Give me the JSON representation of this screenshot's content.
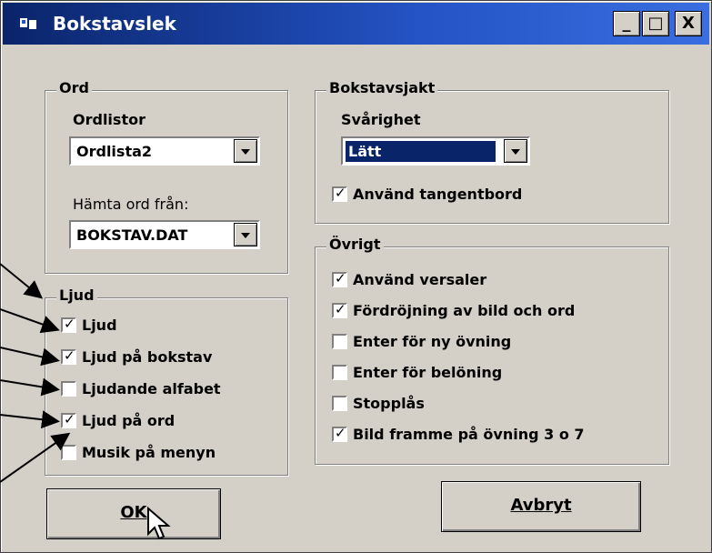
{
  "window": {
    "title": "Bokstavslek",
    "minimize": "_",
    "maximize": "□",
    "close": "X"
  },
  "ord": {
    "legend": "Ord",
    "ordlistor_label": "Ordlistor",
    "ordlistor_value": "Ordlista2",
    "hamta_label": "Hämta ord från:",
    "hamta_value": "BOKSTAV.DAT"
  },
  "bokstavsjakt": {
    "legend": "Bokstavsjakt",
    "svarighet_label": "Svårighet",
    "svarighet_value": "Lätt",
    "tangentbord": {
      "label": "Använd tangentbord",
      "checked": true
    }
  },
  "ljud": {
    "legend": "Ljud",
    "items": [
      {
        "label": "Ljud",
        "checked": true
      },
      {
        "label": "Ljud på bokstav",
        "checked": true
      },
      {
        "label": "Ljudande alfabet",
        "checked": false
      },
      {
        "label": "Ljud på ord",
        "checked": true
      },
      {
        "label": "Musik på menyn",
        "checked": false
      }
    ]
  },
  "ovrigt": {
    "legend": "Övrigt",
    "items": [
      {
        "label": "Använd versaler",
        "checked": true
      },
      {
        "label": "Fördröjning av bild och ord",
        "checked": true
      },
      {
        "label": "Enter för ny övning",
        "checked": false
      },
      {
        "label": "Enter för belöning",
        "checked": false
      },
      {
        "label": "Stopplås",
        "checked": false
      },
      {
        "label": "Bild framme på övning 3 o 7",
        "checked": true
      }
    ]
  },
  "buttons": {
    "ok": "OK",
    "avbryt": "Avbryt"
  },
  "colors": {
    "titlebar": "#0a246a",
    "face": "#d4d0c8",
    "selection": "#0a246a"
  }
}
